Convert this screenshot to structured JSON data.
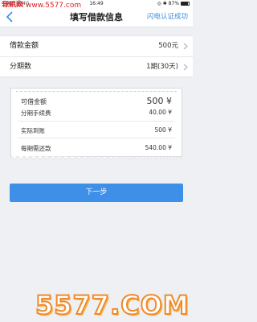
{
  "watermark": {
    "name": "我机网",
    "url": "www.5577.com"
  },
  "status_bar": {
    "left": "中国联通 4G",
    "time": "16:49",
    "battery": "87%"
  },
  "nav": {
    "title": "填写借款信息",
    "right_link": "闪电认证成功",
    "back_icon": "chevron-left-icon"
  },
  "form": {
    "rows": [
      {
        "label": "借款金额",
        "value": "500元"
      },
      {
        "label": "分期数",
        "value": "1期(30天)"
      }
    ]
  },
  "receipt": {
    "rows": [
      {
        "label": "可借金额",
        "value": "500 ¥"
      },
      {
        "label": "分期手续费",
        "value": "40.00 ¥"
      },
      {
        "label": "实际到账",
        "value": "500 ¥"
      },
      {
        "label": "每期需还款",
        "value": "540.00 ¥"
      }
    ]
  },
  "next_button": {
    "label": "下一步"
  },
  "logo": {
    "text": "5577.COM"
  },
  "colors": {
    "accent": "#3d8fe8",
    "link": "#3a8de0",
    "watermark": "#e02020",
    "logo_orange": "#f08a2a"
  }
}
